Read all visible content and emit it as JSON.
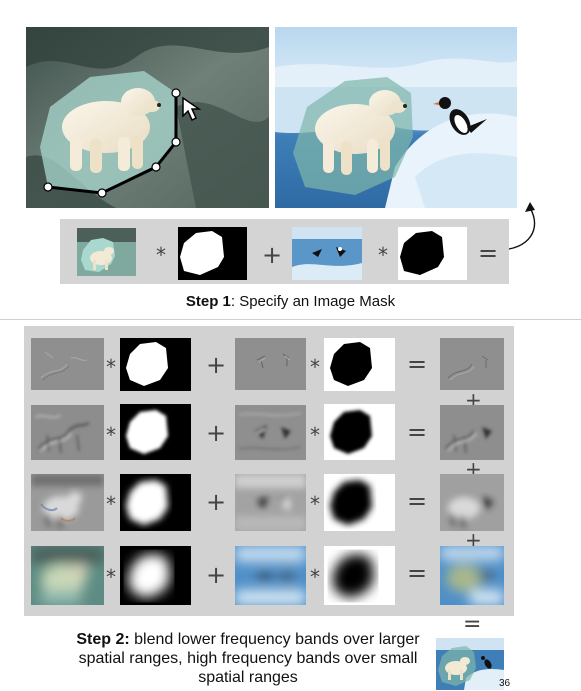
{
  "operators": {
    "multiply": "*",
    "plus": "+",
    "equals": "="
  },
  "step1": {
    "label": "Step 1",
    "text": ": Specify an Image Mask"
  },
  "step2": {
    "label": "Step 2:",
    "text": " blend lower frequency bands over larger spatial ranges, high frequency bands over small spatial ranges"
  },
  "page_number": "36",
  "colors": {
    "panel_gray": "#d2d2d2",
    "ice_blue": "#5f9fd0",
    "cave_green": "#5f7068",
    "mask_black": "#000000",
    "mask_white": "#ffffff"
  },
  "icons": [
    "cursor-arrow-icon",
    "curved-arrow-icon"
  ]
}
